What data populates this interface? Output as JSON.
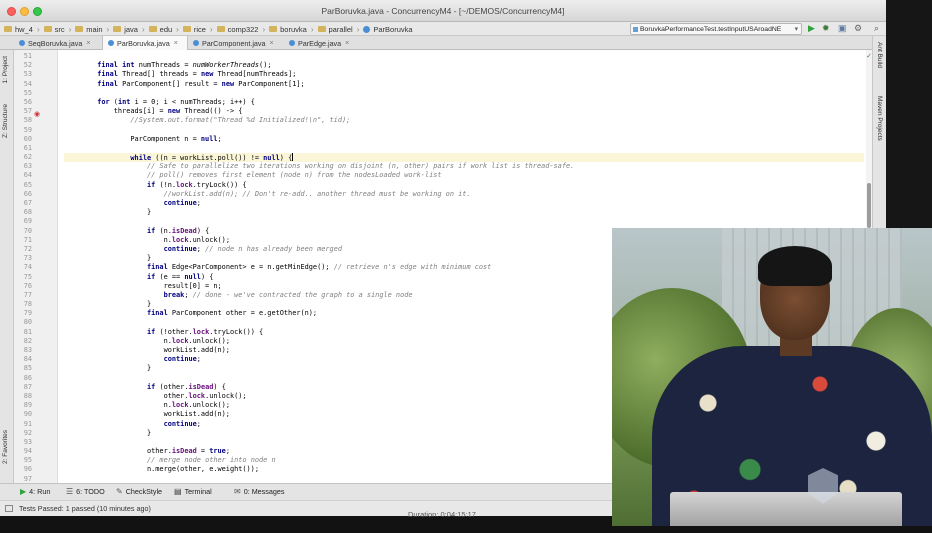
{
  "window": {
    "title": "ParBoruvka.java - ConcurrencyM4 - [~/DEMOS/ConcurrencyM4]"
  },
  "breadcrumbs": [
    "hw_4",
    "src",
    "main",
    "java",
    "edu",
    "rice",
    "comp322",
    "boruvka",
    "parallel",
    "ParBoruvka"
  ],
  "run_config": "BoruvkaPerformanceTest.testInputUSAroadNE",
  "tabs": [
    {
      "label": "SeqBoruvka.java",
      "active": false
    },
    {
      "label": "ParBoruvka.java",
      "active": true
    },
    {
      "label": "ParComponent.java",
      "active": false
    },
    {
      "label": "ParEdge.java",
      "active": false
    }
  ],
  "left_tool_windows": [
    "1: Project",
    "Z: Structure",
    "2: Favorites"
  ],
  "right_tool_windows": [
    "Ant Build",
    "Maven Projects"
  ],
  "editor": {
    "file": "ParBoruvka.java",
    "current_line": 62,
    "line_numbers": [
      "51",
      "52",
      "53",
      "54",
      "55",
      "56",
      "57",
      "58",
      "59",
      "60",
      "61",
      "62",
      "63",
      "64",
      "65",
      "66",
      "67",
      "68",
      "69",
      "70",
      "71",
      "72",
      "73",
      "74",
      "75",
      "76",
      "77",
      "78",
      "79",
      "80",
      "81",
      "82",
      "83",
      "84",
      "85",
      "86",
      "87",
      "88",
      "89",
      "90",
      "91",
      "92",
      "93",
      "94",
      "95",
      "96",
      "97"
    ],
    "lines": [
      "",
      "        final int numThreads = numWorkerThreads();",
      "        final Thread[] threads = new Thread[numThreads];",
      "        final ParComponent[] result = new ParComponent[1];",
      "",
      "        for (int i = 0; i < numThreads; i++) {",
      "            threads[i] = new Thread(() -> {",
      "                //System.out.format(\"Thread %d Initialized!\\n\", tid);",
      "",
      "                ParComponent n = null;",
      "",
      "                while ((n = workList.poll()) != null) {",
      "                    // Safe to parallelize two iterations working on disjoint (n, other) pairs if work list is thread-safe.",
      "                    // poll() removes first element (node n) from the nodesLoaded work-list",
      "                    if (!n.lock.tryLock()) {",
      "                        //workList.add(n); // Don't re-add.. another thread must be working on it.",
      "                        continue;",
      "                    }",
      "",
      "                    if (n.isDead) {",
      "                        n.lock.unlock();",
      "                        continue; // node n has already been merged",
      "                    }",
      "                    final Edge<ParComponent> e = n.getMinEdge(); // retrieve n's edge with minimum cost",
      "                    if (e == null) {",
      "                        result[0] = n;",
      "                        break; // done - we've contracted the graph to a single node",
      "                    }",
      "                    final ParComponent other = e.getOther(n);",
      "",
      "                    if (!other.lock.tryLock()) {",
      "                        n.lock.unlock();",
      "                        workList.add(n);",
      "                        continue;",
      "                    }",
      "",
      "                    if (other.isDead) {",
      "                        other.lock.unlock();",
      "                        n.lock.unlock();",
      "                        workList.add(n);",
      "                        continue;",
      "                    }",
      "",
      "                    other.isDead = true;",
      "                    // merge node other into node n",
      "                    n.merge(other, e.weight());",
      ""
    ]
  },
  "bottom_tools": [
    {
      "label": "4: Run",
      "icon": "play-icon"
    },
    {
      "label": "6: TODO",
      "icon": "todo-icon"
    },
    {
      "label": "CheckStyle",
      "icon": "checkstyle-icon"
    },
    {
      "label": "Terminal",
      "icon": "terminal-icon"
    },
    {
      "label": "0: Messages",
      "icon": "messages-icon"
    }
  ],
  "status": "Tests Passed: 1 passed (10 minutes ago)",
  "video_overlay": {
    "duration_text": "Duration: 0:04:15:17"
  },
  "colors": {
    "keyword": "#000080",
    "comment": "#808080",
    "field": "#660e7a",
    "current_line": "#fbf6d8",
    "tab_active": "#f9f9f9"
  }
}
